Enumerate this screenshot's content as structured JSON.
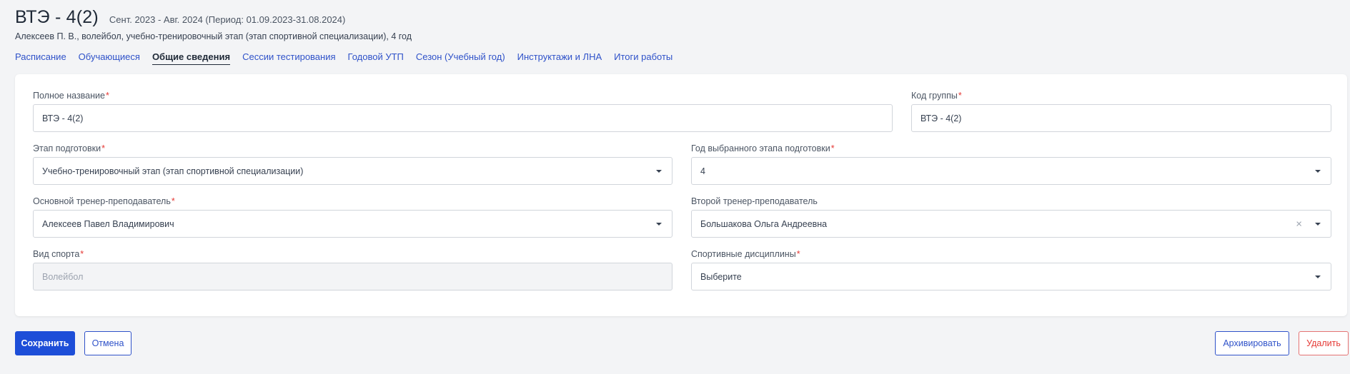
{
  "header": {
    "title": "ВТЭ - 4(2)",
    "period": "Сент. 2023 - Авг. 2024 (Период: 01.09.2023-31.08.2024)",
    "subtitle": "Алексеев П. В., волейбол, учебно-тренировочный этап (этап спортивной специализации), 4 год"
  },
  "tabs": [
    {
      "label": "Расписание"
    },
    {
      "label": "Обучающиеся"
    },
    {
      "label": "Общие сведения"
    },
    {
      "label": "Сессии тестирования"
    },
    {
      "label": "Годовой УТП"
    },
    {
      "label": "Сезон (Учебный год)"
    },
    {
      "label": "Инструктажи и ЛНА"
    },
    {
      "label": "Итоги работы"
    }
  ],
  "active_tab": "Общие сведения",
  "form": {
    "required_mark": "*",
    "full_name": {
      "label": "Полное название",
      "value": "ВТЭ - 4(2)"
    },
    "group_code": {
      "label": "Код группы",
      "value": "ВТЭ - 4(2)"
    },
    "stage": {
      "label": "Этап подготовки",
      "value": "Учебно-тренировочный этап (этап спортивной специализации)"
    },
    "stage_year": {
      "label": "Год выбранного этапа подготовки",
      "value": "4"
    },
    "main_coach": {
      "label": "Основной тренер-преподаватель",
      "value": "Алексеев Павел Владимирович"
    },
    "second_coach": {
      "label": "Второй тренер-преподаватель",
      "value": "Большакова Ольга Андреевна",
      "clear": "×"
    },
    "sport": {
      "label": "Вид спорта",
      "value": "Волейбол"
    },
    "disciplines": {
      "label": "Спортивные дисциплины",
      "value": "Выберите"
    }
  },
  "actions": {
    "save": "Сохранить",
    "cancel": "Отмена",
    "archive": "Архивировать",
    "delete": "Удалить"
  },
  "colors": {
    "accent": "#1d4ed8",
    "link": "#2f52c9",
    "danger": "#e53935",
    "background": "#f3f4f6"
  }
}
